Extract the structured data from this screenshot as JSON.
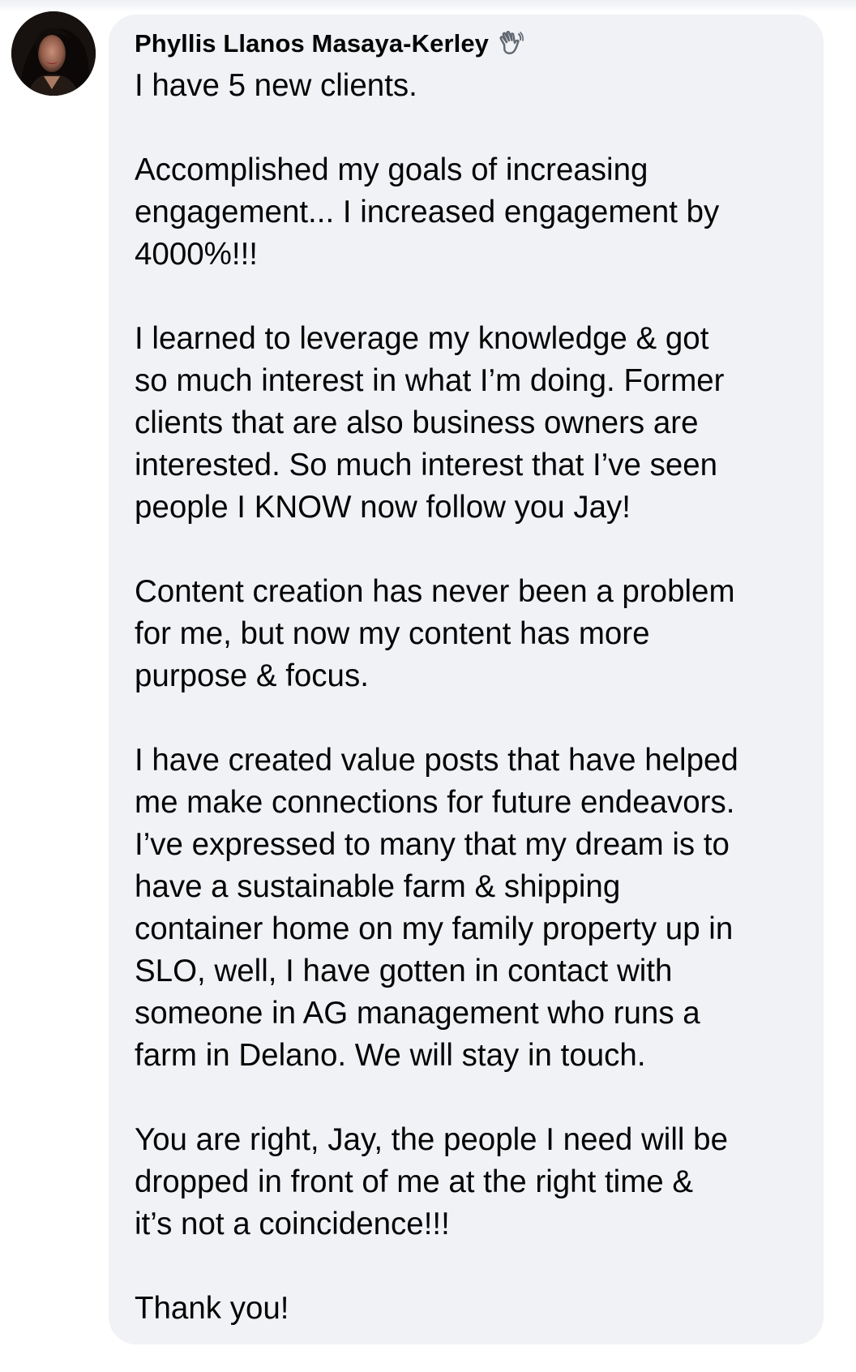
{
  "comment": {
    "author": "Phyllis Llanos Masaya-Kerley",
    "author_badge_icon": "waving-hand-icon",
    "paragraphs": [
      "I have 5 new clients.",
      "Accomplished my goals of increasing\nengagement... I increased engagement by\n4000%!!!",
      "I learned to leverage my knowledge & got\nso much interest in what I’m doing. Former\nclients that are also business owners are\ninterested. So much interest that I’ve seen\npeople I KNOW now follow you Jay!",
      "Content creation has never been a problem\nfor me, but now my content has more\npurpose & focus.",
      "I have created value posts that have helped\nme make connections for future endeavors.\nI’ve expressed to many that my dream is to\nhave a sustainable farm & shipping\ncontainer home on my family property up in\nSLO, well, I have gotten in contact with\nsomeone in AG management who runs a\nfarm in Delano. We will stay in touch.",
      "You are right, Jay, the people I need will be\ndropped in front of me at the right time &\nit’s not a coincidence!!!",
      "Thank you!"
    ]
  },
  "colors": {
    "bubble_background": "#f0f2f5",
    "text": "#050505",
    "page_background": "#ffffff"
  }
}
